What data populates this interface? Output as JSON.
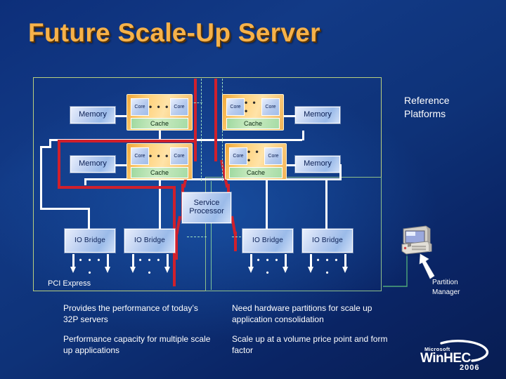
{
  "slide": {
    "title": "Future Scale-Up Server",
    "accent_color": "#f6b24a",
    "background_color": "#0d2f7a"
  },
  "diagram": {
    "memory_label": "Memory",
    "cpu_core_label": "Core",
    "cpu_cache_label": "Cache",
    "core_ellipsis": "• • •",
    "io_bridge_label": "IO Bridge",
    "service_processor_label": "Service\nProcessor",
    "service_processor_line1": "Service",
    "service_processor_line2": "Processor",
    "pci_express_label": "PCI Express",
    "pcie_dots": "• • • •",
    "partition_outline_color": "#d0202c",
    "partition_dashed_color": "#9fe0c0",
    "container_border_color": "#b9cf7e",
    "cpu_color": "#f3b354",
    "cache_color": "#a6dca6",
    "memory_color": "#b9cdf0",
    "memory_boxes": [
      {
        "label": "Memory"
      },
      {
        "label": "Memory"
      },
      {
        "label": "Memory"
      },
      {
        "label": "Memory"
      }
    ],
    "cpu_boxes": [
      {
        "core_left": "Core",
        "core_right": "Core",
        "cache": "Cache"
      },
      {
        "core_left": "Core",
        "core_right": "Core",
        "cache": "Cache"
      },
      {
        "core_left": "Core",
        "core_right": "Core",
        "cache": "Cache"
      },
      {
        "core_left": "Core",
        "core_right": "Core",
        "cache": "Cache"
      }
    ],
    "io_bridges": [
      {
        "label": "IO Bridge"
      },
      {
        "label": "IO Bridge"
      },
      {
        "label": "IO Bridge"
      },
      {
        "label": "IO Bridge"
      }
    ]
  },
  "callouts": {
    "reference_platforms_line1": "Reference",
    "reference_platforms_line2": "Platforms",
    "partition_manager_line1": "Partition",
    "partition_manager_line2": "Manager"
  },
  "bullets": {
    "left": [
      "Provides the performance of today’s 32P servers",
      "Performance capacity for multiple scale up applications"
    ],
    "right": [
      "Need hardware partitions for scale up application consolidation",
      "Scale up at a volume price point and form factor"
    ]
  },
  "logo": {
    "vendor": "Microsoft",
    "name_part1": "Win",
    "name_part2": "HEC",
    "year": "2006"
  }
}
